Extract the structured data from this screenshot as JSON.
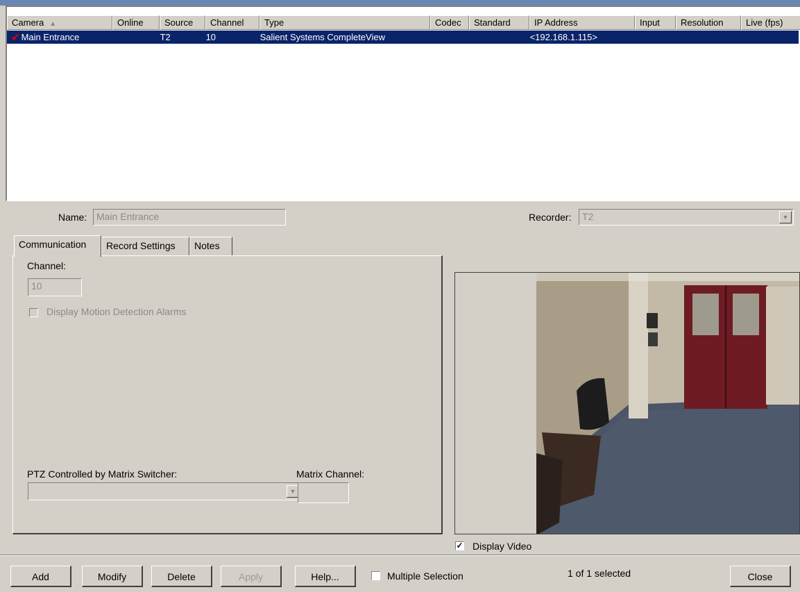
{
  "list": {
    "columns": [
      "Camera",
      "Online",
      "Source",
      "Channel",
      "Type",
      "Codec",
      "Standard",
      "IP Address",
      "Input",
      "Resolution",
      "Live (fps)"
    ],
    "rows": [
      {
        "camera": "Main Entrance",
        "online": "",
        "source": "T2",
        "channel": "10",
        "type": "Salient Systems CompleteView",
        "codec": "",
        "standard": "",
        "ip": "<192.168.1.115>",
        "input": "",
        "resolution": "",
        "live": ""
      }
    ]
  },
  "form": {
    "name_label": "Name:",
    "name_value": "Main Entrance",
    "recorder_label": "Recorder:",
    "recorder_value": "T2"
  },
  "tabs": [
    "Communication",
    "Record Settings",
    "Notes"
  ],
  "communication": {
    "channel_label": "Channel:",
    "channel_value": "10",
    "motion_label": "Display Motion Detection Alarms",
    "ptz_label": "PTZ Controlled by Matrix Switcher:",
    "ptz_value": "",
    "matrix_label": "Matrix Channel:",
    "matrix_value": ""
  },
  "video": {
    "display_label": "Display Video",
    "display_checked": true
  },
  "footer": {
    "add": "Add",
    "modify": "Modify",
    "delete": "Delete",
    "apply": "Apply",
    "help": "Help...",
    "multiple_label": "Multiple Selection",
    "status": "1 of 1 selected",
    "close": "Close"
  },
  "colors": {
    "selection": "#0a246a",
    "face": "#d4d0c8",
    "door": "#6e1b24"
  },
  "icons": {
    "camera_status": "red-check-icon",
    "sort": "sort-up-icon",
    "combo": "chevron-down-icon"
  }
}
